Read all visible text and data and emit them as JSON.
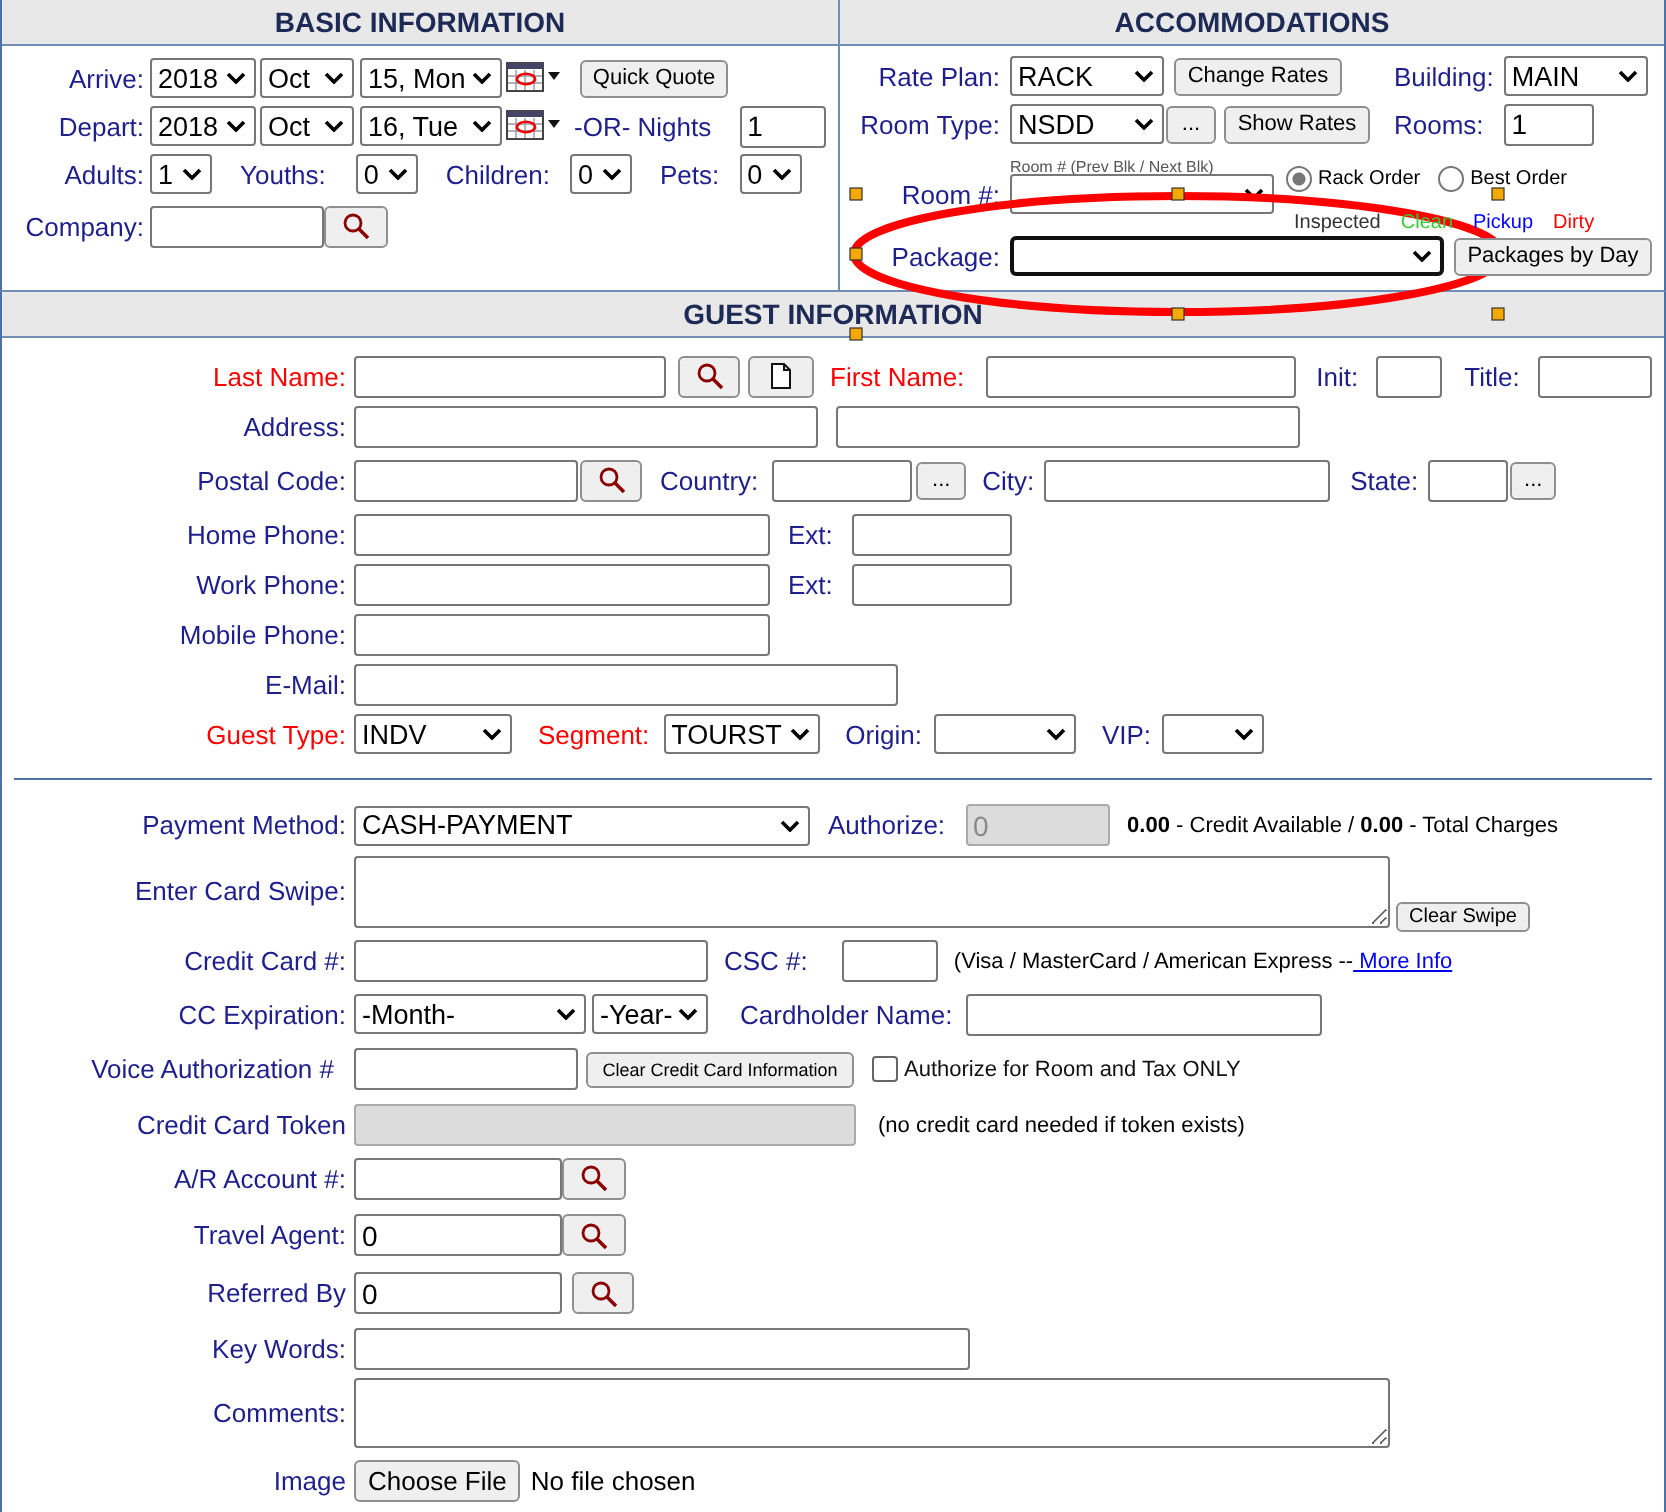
{
  "basic_information": {
    "title": "BASIC INFORMATION",
    "rows": [
      {
        "items": [
          {
            "kind": "label",
            "text": "Arrive:"
          },
          {
            "kind": "select",
            "value": "2018"
          },
          {
            "kind": "select",
            "value": "Oct"
          },
          {
            "kind": "select",
            "value": "15, Mon"
          },
          {
            "kind": "calendar"
          },
          {
            "kind": "button",
            "text": "Quick Quote"
          }
        ]
      },
      {
        "items": [
          {
            "kind": "label",
            "text": "Depart:"
          },
          {
            "kind": "select",
            "value": "2018"
          },
          {
            "kind": "select",
            "value": "Oct"
          },
          {
            "kind": "select",
            "value": "16, Tue"
          },
          {
            "kind": "calendar"
          },
          {
            "kind": "label",
            "text": "-OR- Nights"
          },
          {
            "kind": "input",
            "value": "1"
          }
        ]
      },
      {
        "items": [
          {
            "kind": "label",
            "text": "Adults:"
          },
          {
            "kind": "select",
            "value": "1"
          },
          {
            "kind": "label",
            "text": "Youths:"
          },
          {
            "kind": "select",
            "value": "0"
          },
          {
            "kind": "label",
            "text": "Children:"
          },
          {
            "kind": "select",
            "value": "0"
          },
          {
            "kind": "label",
            "text": "Pets:"
          },
          {
            "kind": "select",
            "value": "0"
          }
        ]
      },
      {
        "items": [
          {
            "kind": "label",
            "text": "Company:"
          },
          {
            "kind": "input"
          },
          {
            "kind": "lookup"
          }
        ]
      }
    ]
  },
  "accommodations": {
    "title": "ACCOMMODATIONS",
    "rows": [
      {
        "items": [
          {
            "kind": "label",
            "text": "Rate Plan:"
          },
          {
            "kind": "select",
            "value": "RACK"
          },
          {
            "kind": "button",
            "text": "Change Rates"
          },
          {
            "kind": "label",
            "text": "Building:"
          },
          {
            "kind": "select",
            "value": "MAIN"
          }
        ]
      },
      {
        "items": [
          {
            "kind": "label",
            "text": "Room Type:"
          },
          {
            "kind": "select",
            "value": "NSDD"
          },
          {
            "kind": "button",
            "text": "..."
          },
          {
            "kind": "button",
            "text": "Show Rates"
          },
          {
            "kind": "label",
            "text": "Rooms:"
          },
          {
            "kind": "input",
            "value": "1"
          }
        ]
      },
      {
        "items": [
          {
            "kind": "hint",
            "text": "Room # (Prev Blk / Next Blk)"
          }
        ]
      },
      {
        "items": [
          {
            "kind": "label",
            "text": "Room #:"
          },
          {
            "kind": "select",
            "value": ""
          },
          {
            "kind": "radio",
            "text": "Rack Order",
            "selected": true
          },
          {
            "kind": "radio",
            "text": "Best Order",
            "selected": false
          }
        ]
      },
      {
        "items": [
          {
            "kind": "legend",
            "entries": [
              {
                "text": "Inspected",
                "color": "#333333"
              },
              {
                "text": "Clean",
                "color": "#33cc33"
              },
              {
                "text": "Pickup",
                "color": "#0000ff"
              },
              {
                "text": "Dirty",
                "color": "#ff0000"
              }
            ]
          }
        ]
      },
      {
        "items": [
          {
            "kind": "label",
            "text": "Package:"
          },
          {
            "kind": "select",
            "value": "",
            "focused": true
          },
          {
            "kind": "button",
            "text": "Packages by Day"
          }
        ]
      }
    ]
  },
  "guest_information": {
    "title": "GUEST INFORMATION",
    "rows": [
      {
        "items": [
          {
            "kind": "label",
            "text": "Last Name:",
            "required": true
          },
          {
            "kind": "input"
          },
          {
            "kind": "lookup"
          },
          {
            "kind": "newdoc"
          },
          {
            "kind": "label",
            "text": "First Name:",
            "required": true
          },
          {
            "kind": "input"
          },
          {
            "kind": "label",
            "text": "Init:"
          },
          {
            "kind": "input"
          },
          {
            "kind": "label",
            "text": "Title:"
          },
          {
            "kind": "input"
          }
        ]
      },
      {
        "items": [
          {
            "kind": "label",
            "text": "Address:"
          },
          {
            "kind": "input"
          },
          {
            "kind": "input"
          }
        ]
      },
      {
        "items": [
          {
            "kind": "label",
            "text": "Postal Code:"
          },
          {
            "kind": "input"
          },
          {
            "kind": "lookup"
          },
          {
            "kind": "label",
            "text": "Country:"
          },
          {
            "kind": "input"
          },
          {
            "kind": "button",
            "text": "..."
          },
          {
            "kind": "label",
            "text": "City:"
          },
          {
            "kind": "input"
          },
          {
            "kind": "label",
            "text": "State:"
          },
          {
            "kind": "input"
          },
          {
            "kind": "button",
            "text": "..."
          }
        ]
      },
      {
        "items": [
          {
            "kind": "label",
            "text": "Home Phone:"
          },
          {
            "kind": "input"
          },
          {
            "kind": "label",
            "text": "Ext:"
          },
          {
            "kind": "input"
          }
        ]
      },
      {
        "items": [
          {
            "kind": "label",
            "text": "Work Phone:"
          },
          {
            "kind": "input"
          },
          {
            "kind": "label",
            "text": "Ext:"
          },
          {
            "kind": "input"
          }
        ]
      },
      {
        "items": [
          {
            "kind": "label",
            "text": "Mobile Phone:"
          },
          {
            "kind": "input"
          }
        ]
      },
      {
        "items": [
          {
            "kind": "label",
            "text": "E-Mail:"
          },
          {
            "kind": "input"
          }
        ]
      },
      {
        "items": [
          {
            "kind": "label",
            "text": "Guest Type:",
            "required": true
          },
          {
            "kind": "select",
            "value": "INDV"
          },
          {
            "kind": "label",
            "text": "Segment:",
            "required": true
          },
          {
            "kind": "select",
            "value": "TOURST"
          },
          {
            "kind": "label",
            "text": "Origin:"
          },
          {
            "kind": "select",
            "value": ""
          },
          {
            "kind": "label",
            "text": "VIP:"
          },
          {
            "kind": "select",
            "value": ""
          }
        ]
      }
    ],
    "payment_rows": [
      {
        "items": [
          {
            "kind": "label",
            "text": "Payment Method:"
          },
          {
            "kind": "select",
            "value": "CASH-PAYMENT"
          },
          {
            "kind": "label",
            "text": "Authorize:"
          },
          {
            "kind": "input",
            "value": "0",
            "disabled": true
          },
          {
            "kind": "note",
            "text": "**0.00** - Credit Available  /  **0.00** - Total Charges"
          }
        ]
      },
      {
        "items": [
          {
            "kind": "label",
            "text": "Enter Card Swipe:"
          },
          {
            "kind": "textarea"
          },
          {
            "kind": "button",
            "text": "Clear Swipe"
          }
        ]
      },
      {
        "items": [
          {
            "kind": "label",
            "text": "Credit Card #:"
          },
          {
            "kind": "input"
          },
          {
            "kind": "label",
            "text": "CSC #:"
          },
          {
            "kind": "input"
          },
          {
            "kind": "note",
            "text": "(Visa / MasterCard / American Express --",
            "link": " More Info"
          }
        ]
      },
      {
        "items": [
          {
            "kind": "label",
            "text": "CC Expiration:"
          },
          {
            "kind": "select",
            "value": "-Month-"
          },
          {
            "kind": "select",
            "value": "-Year-"
          },
          {
            "kind": "label",
            "text": "Cardholder Name:"
          },
          {
            "kind": "input"
          }
        ]
      },
      {
        "items": [
          {
            "kind": "label",
            "text": "Voice Authorization #"
          },
          {
            "kind": "input"
          },
          {
            "kind": "button",
            "text": "Clear Credit Card Information"
          },
          {
            "kind": "checkbox",
            "text": "Authorize for Room and Tax ONLY",
            "checked": false
          }
        ]
      },
      {
        "items": [
          {
            "kind": "label",
            "text": "Credit Card Token"
          },
          {
            "kind": "input",
            "disabled": true
          },
          {
            "kind": "note",
            "text": "(no credit card needed if token exists)"
          }
        ]
      },
      {
        "items": [
          {
            "kind": "label",
            "text": "A/R Account #:"
          },
          {
            "kind": "input"
          },
          {
            "kind": "lookup"
          }
        ]
      },
      {
        "items": [
          {
            "kind": "label",
            "text": "Travel Agent:"
          },
          {
            "kind": "input",
            "value": "0"
          },
          {
            "kind": "lookup"
          }
        ]
      },
      {
        "items": [
          {
            "kind": "label",
            "text": "Referred By"
          },
          {
            "kind": "input",
            "value": "0"
          },
          {
            "kind": "lookup"
          }
        ]
      },
      {
        "items": [
          {
            "kind": "label",
            "text": "Key Words:"
          },
          {
            "kind": "input"
          }
        ]
      },
      {
        "items": [
          {
            "kind": "label",
            "text": "Comments:"
          },
          {
            "kind": "textarea"
          }
        ]
      },
      {
        "items": [
          {
            "kind": "label",
            "text": "Image"
          },
          {
            "kind": "file",
            "button": "Choose File",
            "status": "No file chosen"
          }
        ]
      }
    ]
  }
}
